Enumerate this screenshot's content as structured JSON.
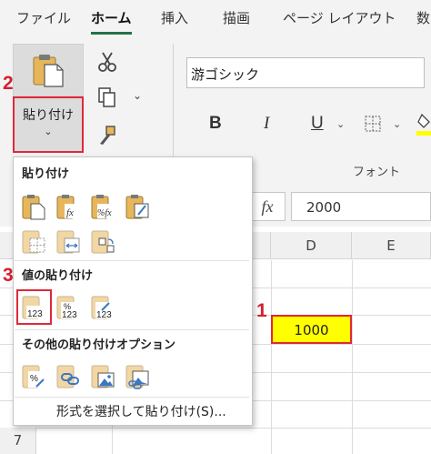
{
  "menubar": {
    "tabs": [
      "ファイル",
      "ホーム",
      "挿入",
      "描画",
      "ページ レイアウト",
      "数"
    ],
    "active_tab": "ホーム"
  },
  "ribbon": {
    "paste_label": "貼り付け",
    "paste_chevron": "⌄",
    "font_name": "游ゴシック",
    "bold_label": "B",
    "italic_label": "I",
    "underline_label": "U",
    "font_group_label": "フォント"
  },
  "formula_bar": {
    "fx_label": "fx",
    "value": "2000"
  },
  "grid": {
    "columns": [
      "D",
      "E"
    ],
    "rows": [
      "7"
    ],
    "cell_d_value": "1000",
    "highlight_color": "#ffff00"
  },
  "annotations": {
    "step1": "1",
    "step2": "2",
    "step3": "3",
    "color": "#d4202e"
  },
  "paste_menu": {
    "section_paste": "貼り付け",
    "section_values": "値の貼り付け",
    "section_other": "その他の貼り付けオプション",
    "special_item": "形式を選択して貼り付け(S)...",
    "icon_fx_1": "fx",
    "icon_fx_2": "%fx",
    "icon_pct": "%",
    "icon_123": "123"
  }
}
